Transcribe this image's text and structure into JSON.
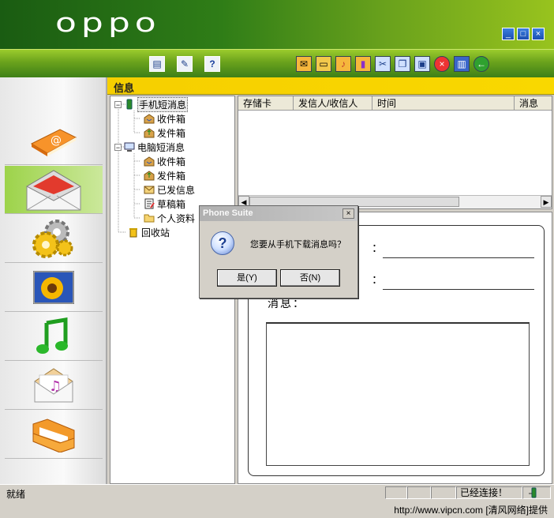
{
  "app": {
    "logo_text": "oppo",
    "window_buttons": [
      "minimize",
      "maximize",
      "close"
    ]
  },
  "toolbar": {
    "left_icons": [
      "document-icon",
      "edit-icon",
      "help-icon"
    ],
    "right_icons": [
      "envelope-icon",
      "folder-open-icon",
      "mail-music-icon",
      "mail-chart-icon",
      "scissors-icon",
      "copy-icon",
      "paste-icon",
      "delete-icon",
      "book-icon",
      "back-icon"
    ]
  },
  "sidebar": {
    "items": [
      {
        "name": "messages-email",
        "icon": "at-book-icon"
      },
      {
        "name": "messages",
        "icon": "envelope-open-icon",
        "active": true
      },
      {
        "name": "settings",
        "icon": "gears-icon"
      },
      {
        "name": "images",
        "icon": "sunflower-photo-icon"
      },
      {
        "name": "music",
        "icon": "music-note-icon"
      },
      {
        "name": "ringtones",
        "icon": "music-mail-icon"
      },
      {
        "name": "files",
        "icon": "folder-icon"
      }
    ]
  },
  "section": {
    "title": "信息"
  },
  "tree": {
    "phone": {
      "label": "手机短消息",
      "toggle": "−"
    },
    "phone_inbox": "收件箱",
    "phone_outbox": "发件箱",
    "pc": {
      "label": "电脑短消息",
      "toggle": "−"
    },
    "pc_inbox": "收件箱",
    "pc_outbox": "发件箱",
    "pc_sent": "已发信息",
    "pc_drafts": "草稿箱",
    "pc_personal": "个人资料",
    "recycle": "回收站"
  },
  "list": {
    "columns": [
      "存储卡",
      "发信人/收信人",
      "时间",
      "消息"
    ]
  },
  "detail": {
    "colon": "：",
    "message_label": "消息："
  },
  "dialog": {
    "title": "Phone Suite",
    "message": "您要从手机下载消息吗？",
    "yes": "是(Y)",
    "no": "否(N)",
    "close": "×"
  },
  "statusbar": {
    "status": "就绪",
    "connection": "已经连接！"
  },
  "footer": {
    "credit": "http://www.vipcn.com [清风网络]提供"
  }
}
